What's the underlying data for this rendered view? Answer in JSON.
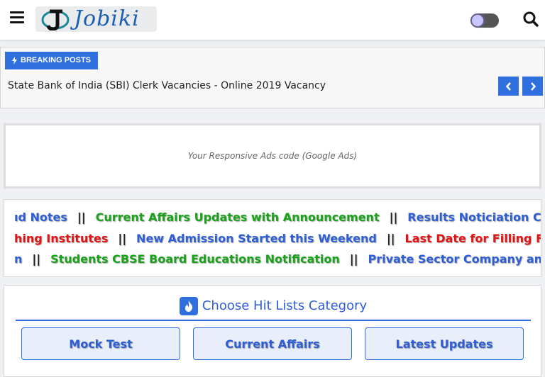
{
  "header": {
    "logo_text": "Jobiki",
    "icons": [
      "menu-icon",
      "logo-j-icon",
      "dark-mode-toggle",
      "search-icon"
    ]
  },
  "breaking": {
    "badge": "BREAKING POSTS",
    "headline": "State Bank of India (SBI) Clerk Vacancies - Online 2019 Vacancy",
    "icons": [
      "bolt-icon",
      "chevron-left-icon",
      "chevron-right-icon"
    ]
  },
  "ads": {
    "text": "Your Responsive Ads code (Google Ads)"
  },
  "marquee": {
    "separator": "||",
    "line1": [
      "ıd Notes",
      "Current Affairs Updates with Announcement",
      "Results Noticiation Coming"
    ],
    "line2": [
      "hing Institutes",
      "New Admission Started this Weekend",
      "Last Date for Filling Form of I"
    ],
    "line3": [
      "n",
      "Students CBSE Board Educations Notification",
      "Private Sector Company and their I"
    ]
  },
  "categories": {
    "title": "Choose Hit Lists Category",
    "buttons": [
      "Mock Test",
      "Current Affairs",
      "Latest Updates"
    ]
  },
  "colors": {
    "primary": "#2f6fde",
    "green": "#1aa31a",
    "red": "#e01414"
  }
}
